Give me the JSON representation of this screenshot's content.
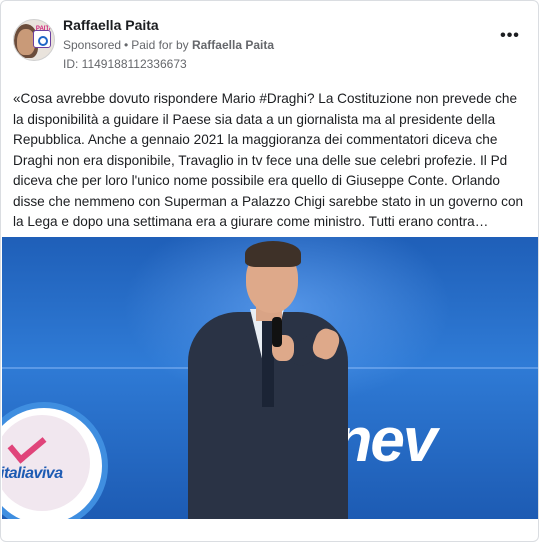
{
  "advertiser": {
    "name": "Raffaella Paita",
    "sponsored_label": "Sponsored",
    "separator": "•",
    "paid_for_prefix": "Paid for by",
    "paid_for_name": "Raffaella Paita",
    "ad_id": "ID: 1149188112336673",
    "avatar_badge_text": "PAITA"
  },
  "more_menu": {
    "label": "•••"
  },
  "post": {
    "text": "«Cosa avrebbe dovuto rispondere Mario #Draghi? La Costituzione non prevede che la disponibilità a guidare il Paese sia data a un giornalista ma al presidente della Repubblica. Anche a gennaio 2021 la maggioranza dei commentatori diceva che Draghi non era disponibile, Travaglio in tv fece una delle sue celebri profezie. Il Pd diceva che per loro l'unico nome possibile era quello di Giuseppe Conte. Orlando disse che nemmeno con Superman a Palazzo Chigi sarebbe stato in un governo con la Lega e dopo una settimana era a giurare come ministro. Tutti erano contra…"
  },
  "image": {
    "logo_text": "italiaviva",
    "backdrop_text": "enev"
  },
  "colors": {
    "meta_gray": "#65676b",
    "stage_blue": "#2f7bd6",
    "logo_pink": "#e0447a"
  }
}
